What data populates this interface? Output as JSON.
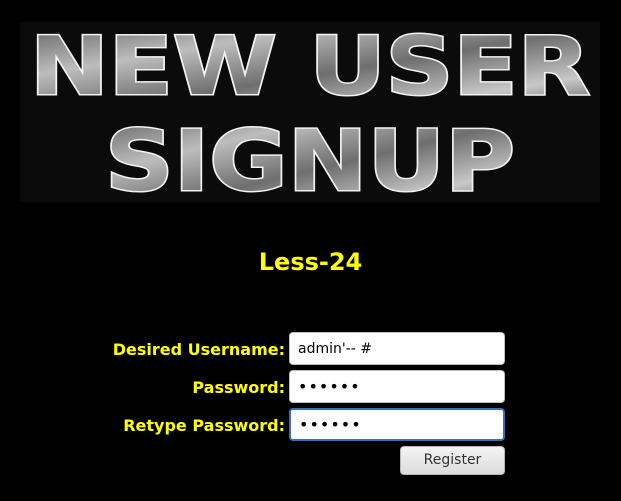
{
  "banner": {
    "line1": "NEW USER",
    "line2": "SIGNUP"
  },
  "subtitle": "Less-24",
  "form": {
    "username_label": "Desired Username:",
    "username_value": "admin'-- #",
    "password_label": "Password:",
    "password_value": "••••••",
    "retype_label": "Retype Password:",
    "retype_value": "••••••",
    "register_label": "Register"
  },
  "colors": {
    "background": "#000000",
    "label": "#ffff00",
    "focus_border": "#3d6eb5"
  }
}
